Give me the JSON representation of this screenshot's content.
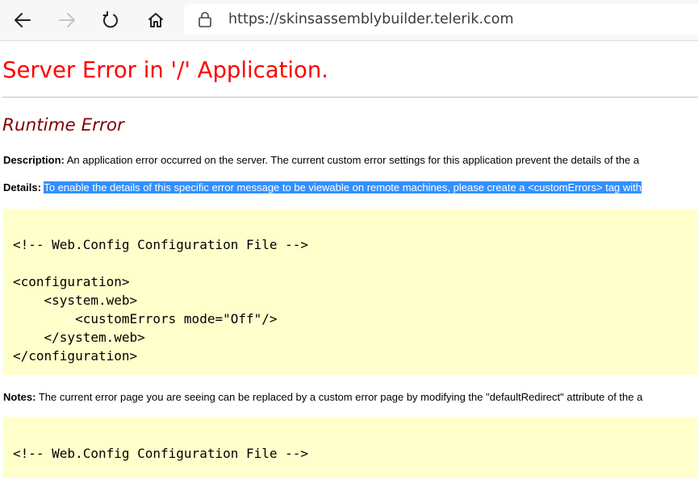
{
  "browser": {
    "url": "https://skinsassemblybuilder.telerik.com"
  },
  "page": {
    "title": "Server Error in '/' Application.",
    "subtitle": "Runtime Error",
    "description_label": "Description:",
    "description_text": "An application error occurred on the server. The current custom error settings for this application prevent the details of the a",
    "details_label": "Details:",
    "details_text": "To enable the details of this specific error message to be viewable on remote machines, please create a <customErrors> tag with",
    "code_block_1": "<!-- Web.Config Configuration File -->\n\n<configuration>\n    <system.web>\n        <customErrors mode=\"Off\"/>\n    </system.web>\n</configuration>",
    "notes_label": "Notes:",
    "notes_text": "The current error page you are seeing can be replaced by a custom error page by modifying the \"defaultRedirect\" attribute of the a",
    "code_block_2": "<!-- Web.Config Configuration File -->"
  },
  "colors": {
    "title": "#ff0000",
    "subtitle": "#800000",
    "code_background": "#ffffcc",
    "selection": "#3390ff"
  },
  "icons": [
    "back-arrow-icon",
    "forward-arrow-icon",
    "refresh-icon",
    "home-icon",
    "lock-icon"
  ]
}
